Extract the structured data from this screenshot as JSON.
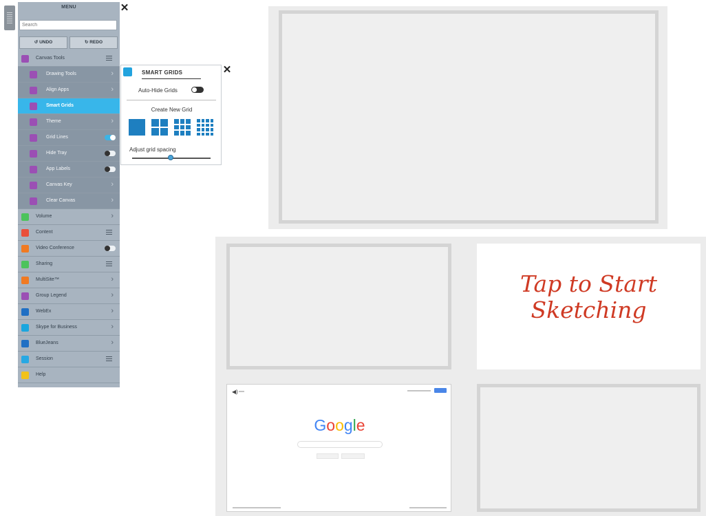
{
  "menu": {
    "title": "MENU",
    "close_icon": "close-icon",
    "search": {
      "placeholder": "Search",
      "value": ""
    },
    "undo_label": "UNDO",
    "redo_label": "REDO",
    "items": [
      {
        "label": "Canvas Tools",
        "level": "top",
        "icon_color": "#9b4fb4",
        "trailing": "list"
      },
      {
        "label": "Drawing Tools",
        "level": "sub",
        "icon_color": "#9b4fb4",
        "trailing": "chevron"
      },
      {
        "label": "Align Apps",
        "level": "sub",
        "icon_color": "#9b4fb4",
        "trailing": "chevron"
      },
      {
        "label": "Smart Grids",
        "level": "selected",
        "icon_color": "#9b4fb4",
        "trailing": "none"
      },
      {
        "label": "Theme",
        "level": "sub",
        "icon_color": "#9b4fb4",
        "trailing": "chevron"
      },
      {
        "label": "Grid Lines",
        "level": "sub",
        "icon_color": "#9b4fb4",
        "trailing": "toggle",
        "toggle_on": true
      },
      {
        "label": "Hide Tray",
        "level": "sub",
        "icon_color": "#9b4fb4",
        "trailing": "toggle",
        "toggle_on": false
      },
      {
        "label": "App Labels",
        "level": "sub",
        "icon_color": "#9b4fb4",
        "trailing": "toggle",
        "toggle_on": false
      },
      {
        "label": "Canvas Key",
        "level": "sub",
        "icon_color": "#9b4fb4",
        "trailing": "chevron"
      },
      {
        "label": "Clear Canvas",
        "level": "sub",
        "icon_color": "#9b4fb4",
        "trailing": "chevron"
      },
      {
        "label": "Volume",
        "level": "top",
        "icon_color": "#4cc35c",
        "trailing": "chevron"
      },
      {
        "label": "Content",
        "level": "top",
        "icon_color": "#e94f3a",
        "trailing": "list"
      },
      {
        "label": "Video Conference",
        "level": "top",
        "icon_color": "#f07a22",
        "trailing": "toggle",
        "toggle_on": false
      },
      {
        "label": "Sharing",
        "level": "top",
        "icon_color": "#4cc35c",
        "trailing": "list"
      },
      {
        "label": "MultiSite™",
        "level": "top",
        "icon_color": "#f07a22",
        "trailing": "chevron"
      },
      {
        "label": "Group Legend",
        "level": "top",
        "icon_color": "#9b4fb4",
        "trailing": "chevron"
      },
      {
        "label": "WebEx",
        "level": "top",
        "icon_color": "#1f6fc4",
        "trailing": "chevron"
      },
      {
        "label": "Skype for Business",
        "level": "top",
        "icon_color": "#1ba6de",
        "trailing": "chevron"
      },
      {
        "label": "BlueJeans",
        "level": "top",
        "icon_color": "#1f6fc4",
        "trailing": "chevron"
      },
      {
        "label": "Session",
        "level": "top",
        "icon_color": "#27a8e3",
        "trailing": "list"
      },
      {
        "label": "Help",
        "level": "top",
        "icon_color": "#f2c21b",
        "trailing": "none"
      }
    ]
  },
  "smart_grids": {
    "title": "SMART GRIDS",
    "auto_hide_label": "Auto-Hide Grids",
    "auto_hide_on": false,
    "create_label": "Create New Grid",
    "grid_options": [
      "1x1",
      "2x2",
      "3x3",
      "4x4"
    ],
    "spacing_label": "Adjust grid spacing",
    "spacing_value": 0.5
  },
  "canvas": {
    "sketch_text_line1": "Tap to Start",
    "sketch_text_line2": "Sketching",
    "google_logo": "Google"
  }
}
